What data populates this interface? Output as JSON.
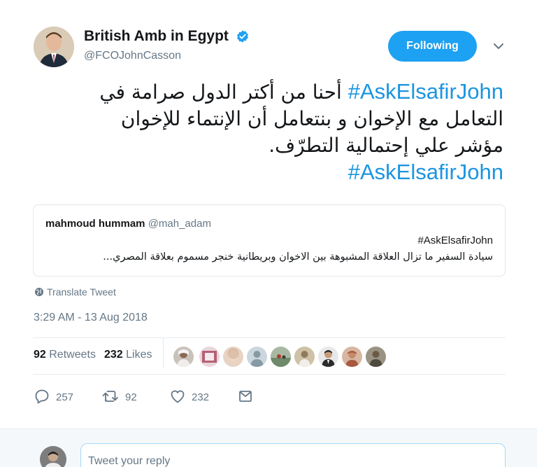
{
  "author": {
    "display_name": "British Amb in Egypt",
    "handle": "@FCOJohnCasson",
    "verified": true
  },
  "follow_button": {
    "label": "Following"
  },
  "tweet": {
    "hashtag": "#AskElsafirJohn",
    "lines": [
      "أحنا من أكتر الدول صرامة في",
      "التعامل مع الإخوان و بنتعامل أن الإنتماء للإخوان",
      "مؤشر علي إحتمالية التطرّف."
    ],
    "hashtag_end": "#AskElsafirJohn"
  },
  "quoted_tweet": {
    "name": "mahmoud hummam",
    "handle": "@mah_adam",
    "hashtag": "#AskElsafirJohn",
    "text": "سيادة السفير ما تزال العلاقة المشبوهة بين الاخوان وبريطانية خنجر مسموم بعلاقة المصري..."
  },
  "translate": {
    "label": "Translate Tweet",
    "icon": "globe-icon"
  },
  "timestamp": "3:29 AM - 13 Aug 2018",
  "stats": {
    "retweets_count": "92",
    "retweets_label": "Retweets",
    "likes_count": "232",
    "likes_label": "Likes"
  },
  "liker_avatars": [
    {
      "icon": "avatar-1",
      "bg": "#c9c2bb"
    },
    {
      "icon": "avatar-2",
      "bg": "#b65f73"
    },
    {
      "icon": "avatar-3",
      "bg": "#e9d3c2"
    },
    {
      "icon": "avatar-4",
      "bg": "#9aa7b2"
    },
    {
      "icon": "avatar-5",
      "bg": "#6f8a6a"
    },
    {
      "icon": "avatar-6",
      "bg": "#8f7a5e"
    },
    {
      "icon": "avatar-7",
      "bg": "#2b2b2b"
    },
    {
      "icon": "avatar-8",
      "bg": "#a8583e"
    },
    {
      "icon": "avatar-9",
      "bg": "#4f4a3e"
    }
  ],
  "actions": {
    "reply_count": "257",
    "retweet_count": "92",
    "like_count": "232"
  },
  "reply": {
    "placeholder": "Tweet your reply"
  },
  "colors": {
    "accent": "#1da1f2",
    "link": "#1b95e0",
    "muted": "#657786"
  }
}
